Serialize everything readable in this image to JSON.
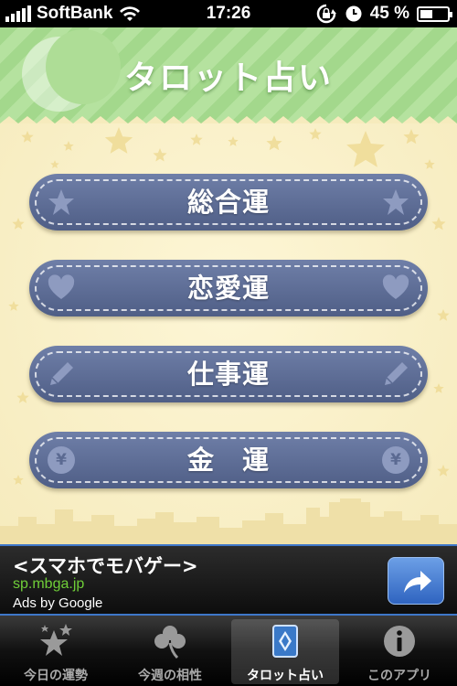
{
  "status_bar": {
    "carrier": "SoftBank",
    "time": "17:26",
    "battery": "45 %",
    "battery_level": 0.45
  },
  "header": {
    "title": "タロット占い"
  },
  "menu": {
    "items": [
      {
        "label": "総合運",
        "icon": "star-icon"
      },
      {
        "label": "恋愛運",
        "icon": "heart-icon"
      },
      {
        "label": "仕事運",
        "icon": "pencil-icon"
      },
      {
        "label": "金　運",
        "icon": "yen-coin-icon"
      }
    ]
  },
  "ad": {
    "title": "<スマホでモバゲー>",
    "url": "sp.mbga.jp",
    "attribution": "Ads by Google",
    "action_icon": "share-arrow-icon"
  },
  "tabs": [
    {
      "label": "今日の運勢",
      "icon": "stars-icon",
      "active": false
    },
    {
      "label": "今週の相性",
      "icon": "clover-icon",
      "active": false
    },
    {
      "label": "タロット占い",
      "icon": "tarot-card-icon",
      "active": true
    },
    {
      "label": "このアプリ",
      "icon": "info-icon",
      "active": false
    }
  ],
  "colors": {
    "header_green": "#a3d88c",
    "button_blue": "#5a6a94",
    "background_cream": "#f6ebbd",
    "ad_border": "#3e77c9",
    "ad_url_green": "#6fce38"
  }
}
